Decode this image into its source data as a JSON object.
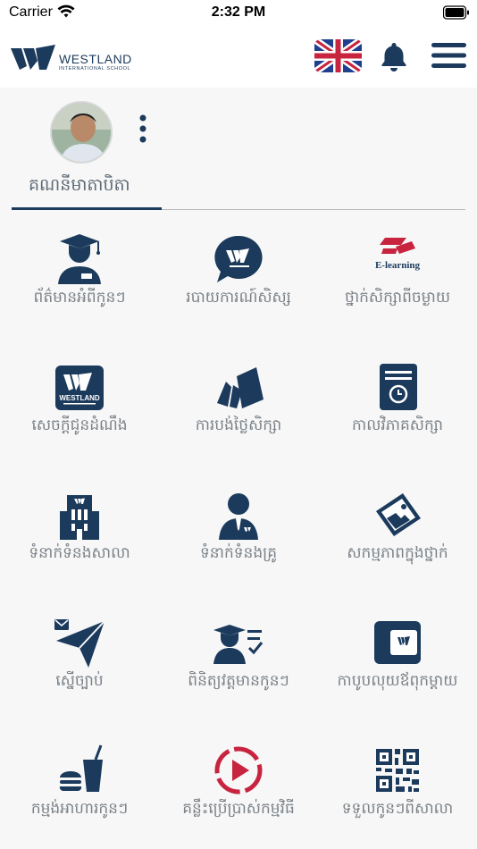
{
  "status_bar": {
    "carrier": "Carrier",
    "time": "2:32 PM"
  },
  "header": {
    "logo_name": "WESTLAND",
    "logo_subtitle": "INTERNATIONAL SCHOOL"
  },
  "profile": {
    "tab_label": "គណនីមាតាបិតា"
  },
  "menu": [
    {
      "label": "ព័ត៌មានអំពីកូនៗ",
      "icon": "graduate-icon"
    },
    {
      "label": "របាយការណ៍សិស្ស",
      "icon": "chat-bubble-logo-icon"
    },
    {
      "label": "ថ្នាក់សិក្សាពីចម្ងាយ",
      "icon": "e-learning-icon",
      "icon_text": "E-learning"
    },
    {
      "label": "សេចក្តីជូនដំណឹង",
      "icon": "westland-logo-icon",
      "icon_text": "WESTLAND"
    },
    {
      "label": "ការបង់ថ្លៃសិក្សា",
      "icon": "payment-cards-icon"
    },
    {
      "label": "កាលវិភាគសិក្សា",
      "icon": "schedule-book-icon"
    },
    {
      "label": "ទំនាក់ទំនងសាលា",
      "icon": "school-building-icon"
    },
    {
      "label": "ទំនាក់ទំនងគ្រូ",
      "icon": "teacher-icon"
    },
    {
      "label": "សកម្មភាពក្នុងថ្នាក់",
      "icon": "photo-icon"
    },
    {
      "label": "ស្នើច្បាប់",
      "icon": "paper-plane-icon"
    },
    {
      "label": "ពិនិត្យវត្តមានកូនៗ",
      "icon": "attendance-icon"
    },
    {
      "label": "កាបូបលុយឪពុកម្តាយ",
      "icon": "wallet-icon"
    },
    {
      "label": "កម្មង់អាហារកូនៗ",
      "icon": "food-order-icon"
    },
    {
      "label": "គន្លឹះប្រើប្រាស់កម្មវិធី",
      "icon": "video-tips-icon"
    },
    {
      "label": "ទទួលកូនៗពីសាលា",
      "icon": "qr-code-icon"
    }
  ],
  "colors": {
    "navy": "#1b3a5c",
    "red": "#c8233f",
    "label_gray": "#7a8187"
  }
}
